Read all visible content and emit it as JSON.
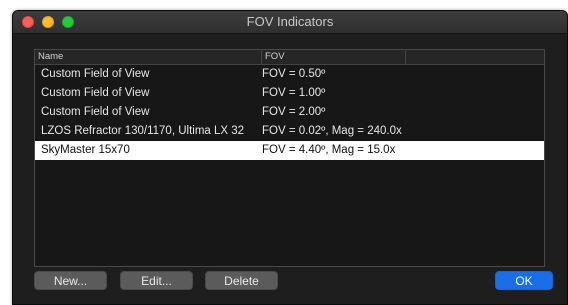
{
  "window": {
    "title": "FOV Indicators"
  },
  "table": {
    "columns": [
      "Name",
      "FOV"
    ],
    "rows": [
      {
        "name": "Custom Field of View",
        "fov": "FOV = 0.50º"
      },
      {
        "name": "Custom Field of View",
        "fov": "FOV = 1.00º"
      },
      {
        "name": "Custom Field of View",
        "fov": "FOV = 2.00º"
      },
      {
        "name": "LZOS Refractor 130/1170, Ultima LX 32",
        "fov": "FOV = 0.02º, Mag = 240.0x"
      },
      {
        "name": "SkyMaster 15x70",
        "fov": "FOV = 4.40º, Mag = 15.0x"
      }
    ],
    "selected_row": 4
  },
  "buttons": {
    "new": "New...",
    "edit": "Edit...",
    "delete": "Delete",
    "ok": "OK"
  },
  "colors": {
    "accent": "#1a6fe8",
    "selection": "#ffffff"
  }
}
